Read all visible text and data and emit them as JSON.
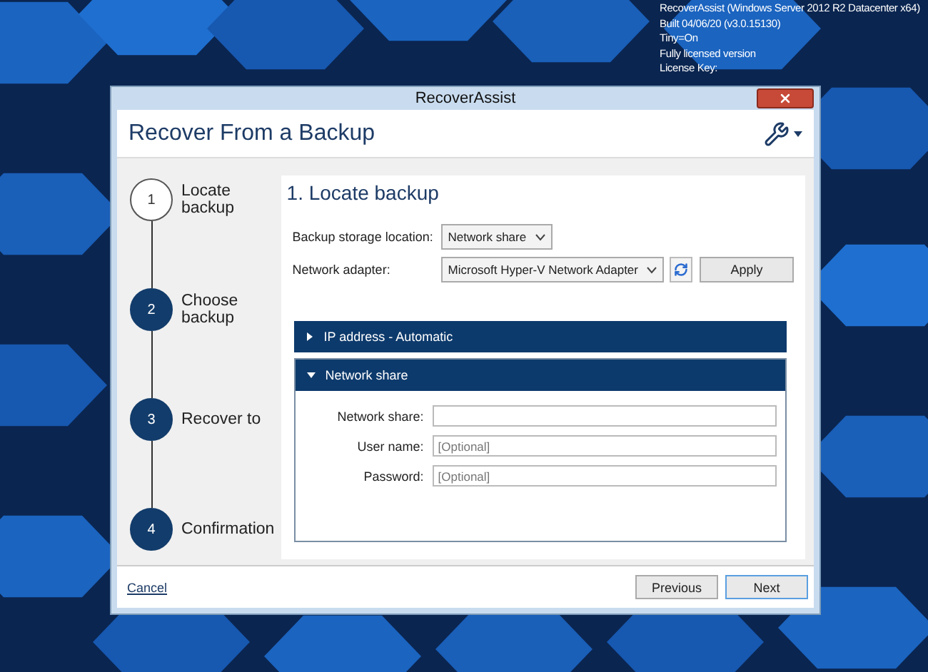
{
  "desktop_info": [
    "RecoverAssist (Windows Server 2012 R2 Datacenter x64)",
    "Built 04/06/20 (v3.0.15130)",
    "Tiny=On",
    "Fully licensed version",
    "License Key:"
  ],
  "window": {
    "title": "RecoverAssist",
    "heading": "Recover From a Backup"
  },
  "steps": [
    {
      "number": "1",
      "label": "Locate backup",
      "selected": true
    },
    {
      "number": "2",
      "label": "Choose backup",
      "selected": false
    },
    {
      "number": "3",
      "label": "Recover to",
      "selected": false
    },
    {
      "number": "4",
      "label": "Confirmation",
      "selected": false
    }
  ],
  "page": {
    "title": "1. Locate backup",
    "settings": [
      {
        "label": "Backup storage location:",
        "value": "Network share"
      },
      {
        "label": "Network adapter:",
        "value": "Microsoft Hyper-V Network Adapter",
        "apply_button": "Apply"
      }
    ]
  },
  "sections": [
    {
      "title": "IP address - Automatic",
      "expanded": false
    },
    {
      "title": "Network share",
      "expanded": true,
      "fields": [
        {
          "label": "Network share:"
        },
        {
          "label": "User name:",
          "placeholder": "[Optional]"
        },
        {
          "label": "Password:",
          "placeholder": "[Optional]"
        }
      ]
    }
  ],
  "footer": {
    "cancel": "Cancel",
    "buttons": [
      {
        "label": "Previous",
        "default": false
      },
      {
        "label": "Next",
        "default": true
      }
    ]
  }
}
